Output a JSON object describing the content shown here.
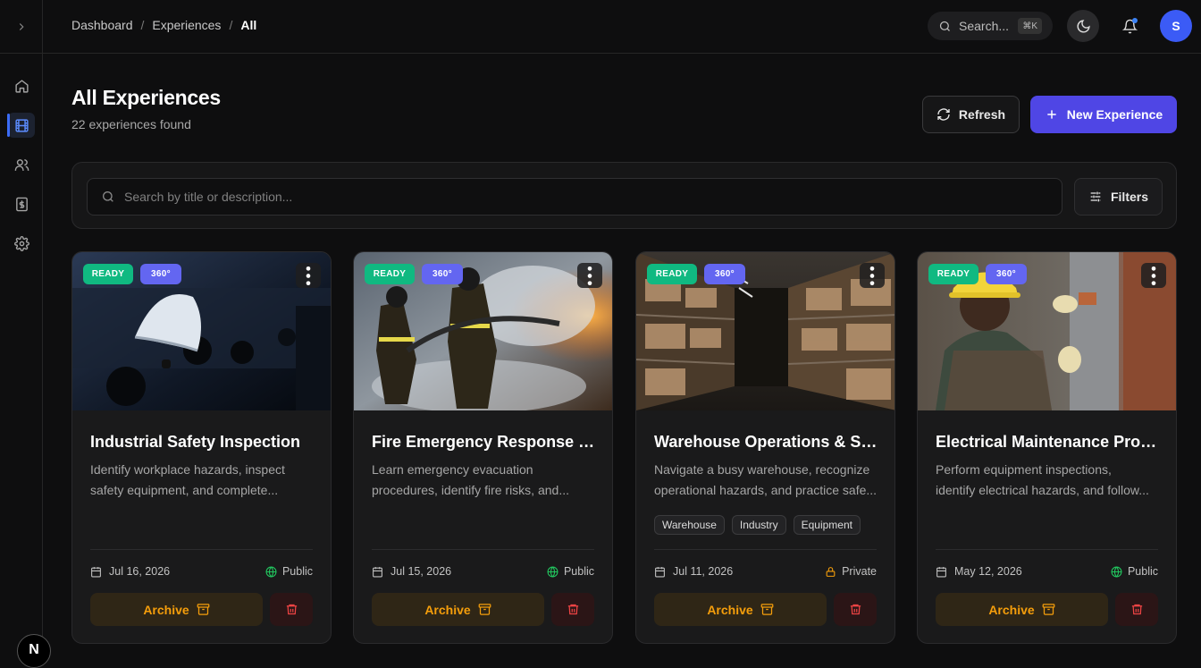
{
  "breadcrumb": [
    "Dashboard",
    "Experiences",
    "All"
  ],
  "topbar": {
    "search_label": "Search...",
    "search_shortcut": "⌘K",
    "avatar_initial": "S"
  },
  "sidebar": {
    "items": [
      {
        "name": "home",
        "icon": "home-icon"
      },
      {
        "name": "experiences",
        "icon": "film-icon",
        "active": true
      },
      {
        "name": "users",
        "icon": "users-icon"
      },
      {
        "name": "billing",
        "icon": "dollar-icon"
      },
      {
        "name": "settings",
        "icon": "gear-icon"
      }
    ],
    "logo_letter": "N"
  },
  "page": {
    "title": "All Experiences",
    "subtitle": "22 experiences found"
  },
  "actions": {
    "refresh_label": "Refresh",
    "new_label": "New Experience"
  },
  "filters": {
    "search_placeholder": "Search by title or description...",
    "filters_label": "Filters"
  },
  "colors": {
    "accent": "#4f46e5",
    "ready": "#10b981",
    "badge_360": "#6366f1",
    "archive": "#f59e0b",
    "delete": "#ef4444",
    "public": "#22c55e",
    "private": "#f59e0b"
  },
  "cards": [
    {
      "status": "READY",
      "mode": "360°",
      "title": "Industrial Safety Inspection",
      "desc_line1": "Identify workplace hazards, inspect",
      "desc_line2": "safety equipment, and complete...",
      "tags": [],
      "date": "Jul 16, 2026",
      "visibility": "Public",
      "archive_label": "Archive"
    },
    {
      "status": "READY",
      "mode": "360°",
      "title": "Fire Emergency Response Training",
      "desc_line1": "Learn emergency evacuation",
      "desc_line2": "procedures, identify fire risks, and...",
      "tags": [],
      "date": "Jul 15, 2026",
      "visibility": "Public",
      "archive_label": "Archive"
    },
    {
      "status": "READY",
      "mode": "360°",
      "title": "Warehouse Operations & Safety",
      "desc_line1": "Navigate a busy warehouse, recognize",
      "desc_line2": "operational hazards, and practice safe...",
      "tags": [
        "Warehouse",
        "Industry",
        "Equipment"
      ],
      "date": "Jul 11, 2026",
      "visibility": "Private",
      "archive_label": "Archive"
    },
    {
      "status": "READY",
      "mode": "360°",
      "title": "Electrical Maintenance Procedures",
      "desc_line1": "Perform equipment inspections,",
      "desc_line2": "identify electrical hazards, and follow...",
      "tags": [],
      "date": "May 12, 2026",
      "visibility": "Public",
      "archive_label": "Archive"
    }
  ]
}
